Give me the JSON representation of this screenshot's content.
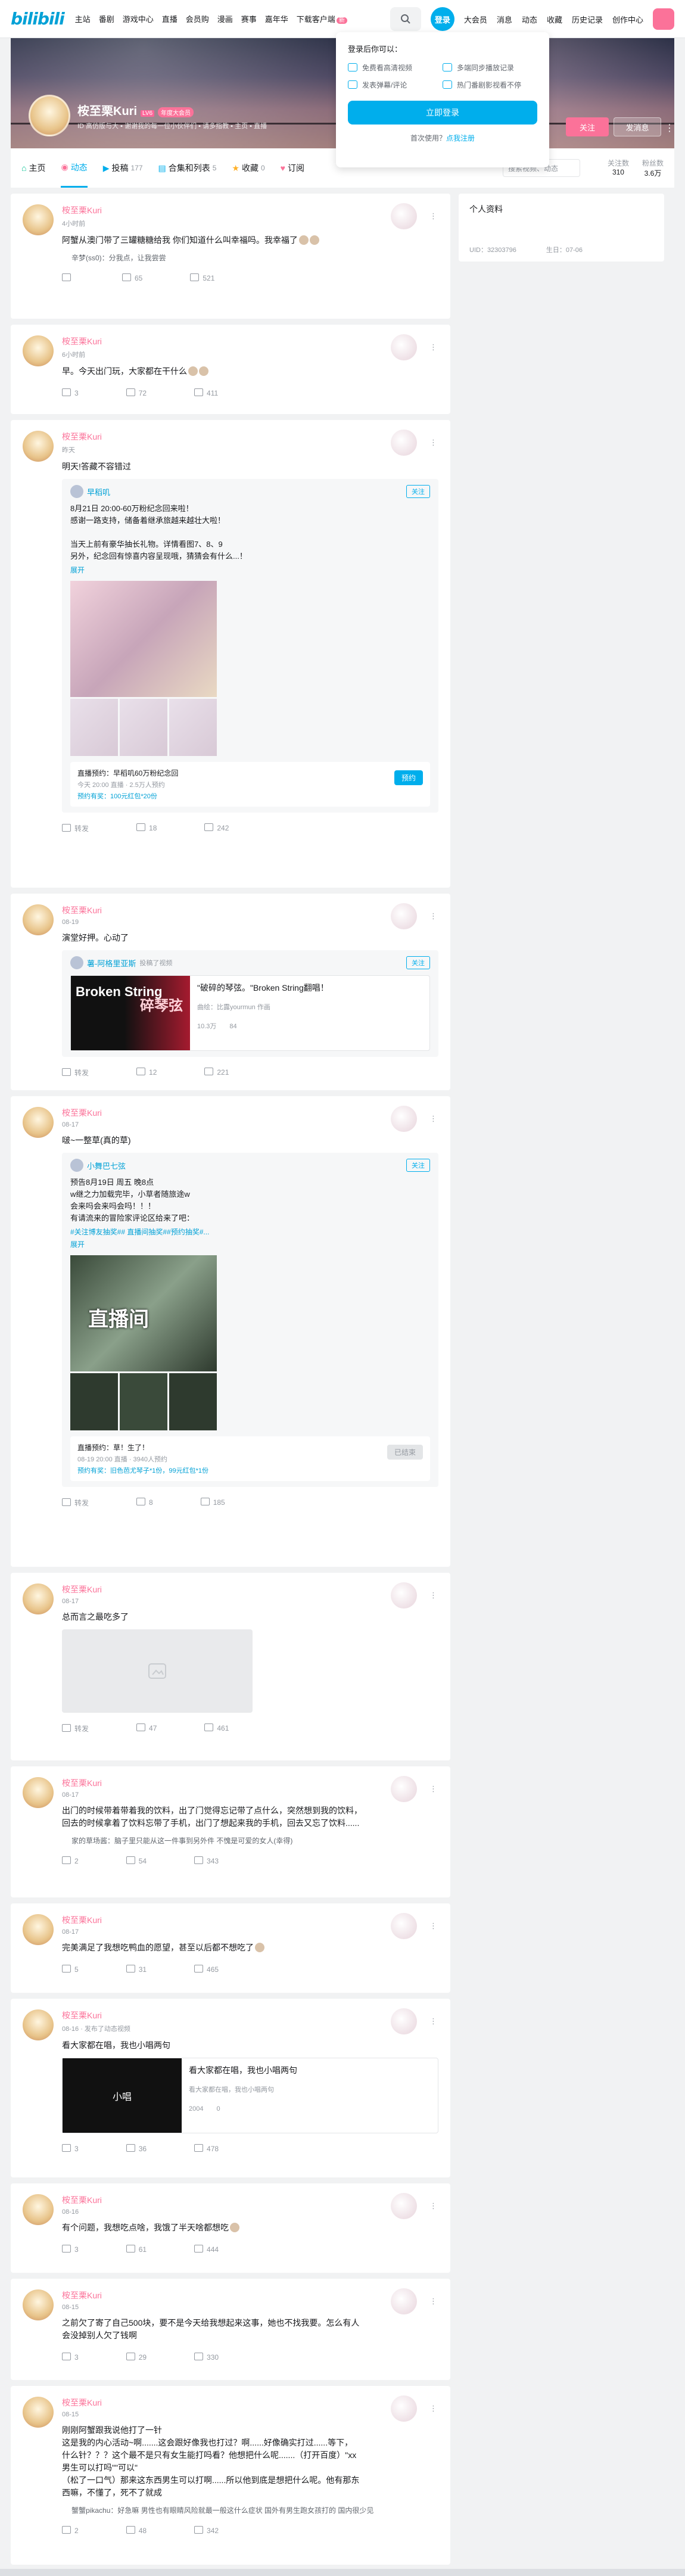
{
  "header": {
    "logo": "bilibili",
    "nav": [
      "主站",
      "番剧",
      "游戏中心",
      "直播",
      "会员购",
      "漫画",
      "赛事",
      "嘉年华",
      "下载客户端"
    ],
    "download_badge": "新",
    "login_avatar": "登录",
    "right": [
      "大会员",
      "消息",
      "动态",
      "收藏",
      "历史记录",
      "创作中心"
    ]
  },
  "login_popup": {
    "title": "登录后你可以：",
    "features": [
      "免费看高清视频",
      "多端同步播放记录",
      "发表弹幕/评论",
      "热门番剧影视看不停"
    ],
    "button": "立即登录",
    "register_prompt": "首次使用？",
    "register_link": "点我注册"
  },
  "profile": {
    "name": "桉至栗Kuri",
    "level": "LV6",
    "vip": "年度大会员",
    "sign": "ID 高仿版与大 ▪ 谢谢我的每一位小伙伴们 ▪ 请多指教 ▪ 主页 ▪ 直播",
    "follow_btn": "关注",
    "msg_btn": "发消息"
  },
  "tabs": [
    {
      "label": "主页",
      "count": ""
    },
    {
      "label": "动态",
      "count": ""
    },
    {
      "label": "投稿",
      "count": "177"
    },
    {
      "label": "合集和列表",
      "count": "5"
    },
    {
      "label": "收藏",
      "count": "0"
    },
    {
      "label": "订阅",
      "count": ""
    }
  ],
  "tab_search_placeholder": "搜索视频、动态",
  "stats": [
    {
      "label": "关注数",
      "value": "310"
    },
    {
      "label": "粉丝数",
      "value": "3.6万"
    }
  ],
  "side": {
    "title": "个人资料",
    "uid": "UID：32303796",
    "birthday": "生日：07-06"
  },
  "posts": [
    {
      "name": "桉至栗Kuri",
      "time": "4小时前",
      "text": "阿蟹从澳门带了三罐糖糖给我 你们知道什么叫幸福吗。我幸福了",
      "hot": "辛梦(ss0)：分我点，让我尝尝",
      "actions": [
        "",
        "65",
        "521"
      ]
    },
    {
      "name": "桉至栗Kuri",
      "time": "6小时前",
      "text": "早。今天出门玩，大家都在干什么",
      "actions": [
        "3",
        "72",
        "411"
      ]
    },
    {
      "name": "桉至栗Kuri",
      "time": "昨天",
      "text": "明天!答藏不容错过",
      "inner_name": "早稻叽",
      "inner_follow": "关注",
      "inner_text": "8月21日 20:00-60万粉纪念回来啦！\n感谢一路支持，储备着继承旅越来越壮大啦！\n\n当天上前有豪华抽长礼物。详情看图7、8、9\n另外，纪念回有惊喜内容呈现哦，猜猜会有什么...！",
      "expand": "展开",
      "resv_title": "直播预约：早稻叽60万粉纪念回",
      "resv_sub": "今天 20:00 直播 · 2.5万人预约",
      "resv_link": "预约有奖：100元红包*20份",
      "resv_btn": "预约",
      "actions": [
        "转发",
        "18",
        "242"
      ]
    },
    {
      "name": "桉至栗Kuri",
      "time": "08-19",
      "text": "演堂好押。心动了",
      "inner_name": "薯-阿格里亚斯",
      "inner_sub": "投稿了视频",
      "inner_follow": "关注",
      "video_title": "\"破碎的琴弦。\"Broken String翻唱！",
      "video_desc": "曲绘：比露yourmun 作画",
      "video_cover": "Broken String",
      "video_cover_cn": "碎琴弦",
      "video_stats": [
        "10.3万",
        "84"
      ],
      "actions": [
        "转发",
        "12",
        "221"
      ]
    },
    {
      "name": "桉至栗Kuri",
      "time": "08-17",
      "text": "啵~一整草(真的草)",
      "inner_name": "小舞巴七弦",
      "inner_follow": "关注",
      "inner_text": "预告8月19日 周五 晚8点\nw继之力加载完毕，小草者随旅途w\n会来吗会来吗会吗！！！\n有请流来的冒险家评论区给来了吧：",
      "inner_tags": "#关注博友抽奖## 直播间抽奖##预约抽奖#...",
      "expand": "展开",
      "cover_text": "直播间",
      "resv_title": "直播预约：草！生了！",
      "resv_sub": "08-19 20:00 直播 · 3940人预约",
      "resv_link": "预约有奖：旧色芭尤琴子*1份，99元红包*1份",
      "resv_btn": "已结束",
      "actions": [
        "转发",
        "8",
        "185"
      ]
    },
    {
      "name": "桉至栗Kuri",
      "time": "08-17",
      "text": "总而言之最吃多了",
      "actions": [
        "转发",
        "47",
        "461"
      ]
    },
    {
      "name": "桉至栗Kuri",
      "time": "08-17",
      "text": "出门的时候带着带着我的饮料，出了门觉得忘记带了点什么，突然想到我的饮料，\n回去的时候拿着了饮料忘带了手机，出门了想起来我的手机，回去又忘了饮料......",
      "hot": "家的草场酱：脑子里只能从这一件事到另外件 不愧是可爱的女人(幸得)",
      "actions": [
        "2",
        "54",
        "343"
      ]
    },
    {
      "name": "桉至栗Kuri",
      "time": "08-17",
      "text": "完美满足了我想吃鸭血的愿望，甚至以后都不想吃了",
      "actions": [
        "5",
        "31",
        "465"
      ]
    },
    {
      "name": "桉至栗Kuri",
      "time": "08-16 · 发布了动态视频",
      "text": "看大家都在唱，我也小唱两句",
      "video_title": "看大家都在唱，我也小唱两句",
      "video_desc": "看大家都在唱，我也小唱两句",
      "video_cover": "小唱",
      "video_stats": [
        "2004",
        "0"
      ],
      "actions": [
        "3",
        "36",
        "478"
      ]
    },
    {
      "name": "桉至栗Kuri",
      "time": "08-16",
      "text": "有个问题，我想吃点啥，我饿了半天啥都想吃",
      "actions": [
        "3",
        "61",
        "444"
      ]
    },
    {
      "name": "桉至栗Kuri",
      "time": "08-15",
      "text": "之前欠了寄了自己500块，要不是今天给我想起来这事，她也不找我要。怎么有人\n会没掉别人欠了钱啊",
      "actions": [
        "3",
        "29",
        "330"
      ]
    },
    {
      "name": "桉至栗Kuri",
      "time": "08-15",
      "text": "刚刚阿蟹跟我说他打了一针\n这是我的内心活动~啊.......这会跟好像我也打过？啊......好像确实打过......等下，\n什么针？？？这个最不是只有女生能打吗看？他想把什么呢.......（打开百度）\"xx\n男生可以打吗\"\"可以\"\n（松了一口气）那来这东西男生可以打啊......所以他到底是想把什么呢。他有那东\n西嘛，不懂了，死不了就成",
      "hot": "蟹蟹pikachu：好急嘛 男性也有眼睛风险就最一般这什么症状 国外有男生跑女孩打的 国内很少见",
      "actions": [
        "2",
        "48",
        "342"
      ]
    }
  ]
}
